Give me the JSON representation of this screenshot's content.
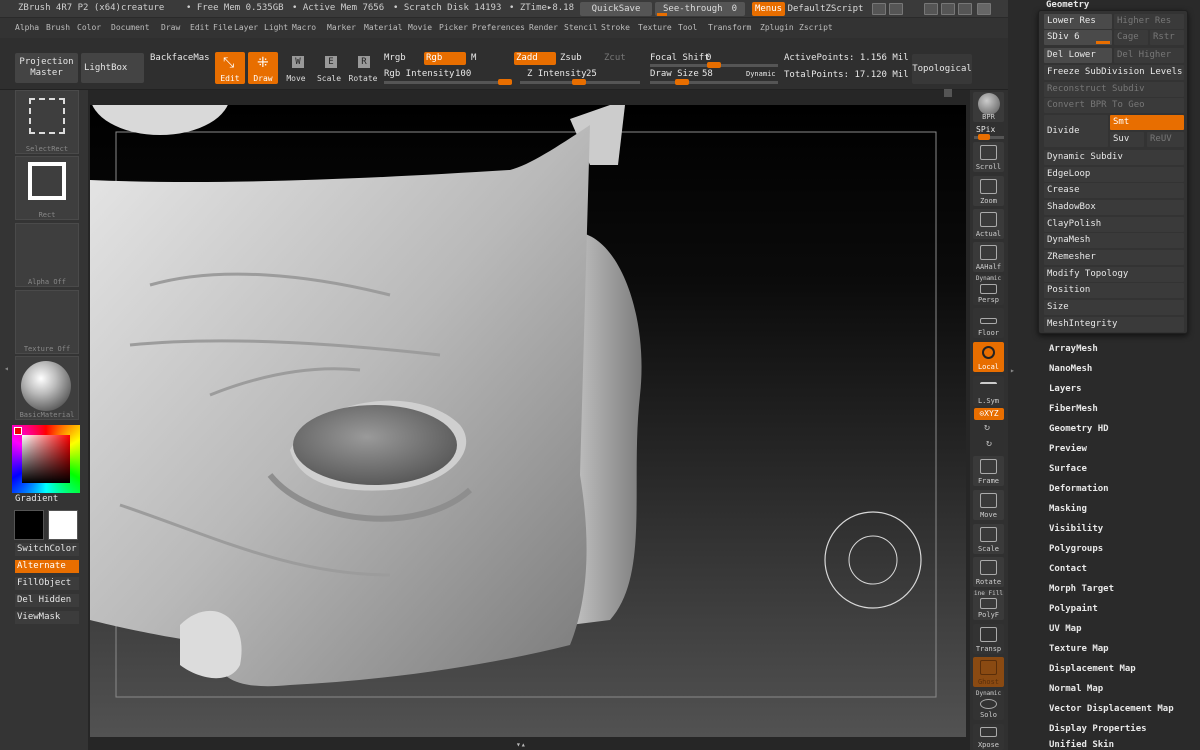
{
  "titlebar": {
    "app_title": "ZBrush 4R7 P2 (x64)creature",
    "free_mem": "• Free Mem 0.535GB",
    "active_mem": "• Active Mem 7656",
    "scratch_disk": "• Scratch Disk 14193",
    "ztime": "• ZTime▸8.18",
    "quicksave": "QuickSave",
    "seethrough": "See-through",
    "seethrough_value": "0",
    "menus": "Menus",
    "defaultzscript": "DefaultZScript"
  },
  "menubar": [
    "Alpha",
    "Brush",
    "Color",
    "Document",
    "Draw",
    "Edit",
    "File",
    "Layer",
    "Light",
    "Macro",
    "Marker",
    "Material",
    "Movie",
    "Picker",
    "Preferences",
    "Render",
    "Stencil",
    "Stroke",
    "Texture",
    "Tool",
    "Transform",
    "Zplugin",
    "Zscript"
  ],
  "shelf": {
    "projection_master": "Projection Master",
    "lightbox": "LightBox",
    "backface": "BackfaceMas",
    "edit": "Edit",
    "draw": "Draw",
    "move": "Move",
    "scale": "Scale",
    "rotate": "Rotate",
    "mrgb": "Mrgb",
    "rgb": "Rgb",
    "m": "M",
    "zadd": "Zadd",
    "zsub": "Zsub",
    "zcut": "Zcut",
    "rgb_intensity_label": "Rgb Intensity",
    "rgb_intensity": "100",
    "z_intensity_label": "Z Intensity",
    "z_intensity": "25",
    "focal_shift_label": "Focal Shift",
    "focal_shift": "0",
    "draw_size_label": "Draw Size",
    "draw_size": "58",
    "dynamic": "Dynamic",
    "active_points": "ActivePoints: 1.156 Mil",
    "total_points": "TotalPoints: 17.120 Mil",
    "topological": "Topological"
  },
  "leftpanel": {
    "selectrect": "SelectRect",
    "rect": "Rect",
    "alpha_off": "Alpha Off",
    "texture_off": "Texture Off",
    "basicmaterial": "BasicMaterial",
    "gradient": "Gradient",
    "switchcolor": "SwitchColor",
    "alternate": "Alternate",
    "fillobject": "FillObject",
    "del_hidden": "Del Hidden",
    "viewmask": "ViewMask"
  },
  "righttoolbar": {
    "bpr": "BPR",
    "spix": "SPix",
    "scroll": "Scroll",
    "zoom": "Zoom",
    "actual": "Actual",
    "aahalf": "AAHalf",
    "dynamic": "Dynamic",
    "persp": "Persp",
    "floor": "Floor",
    "local": "Local",
    "lsym": "L.Sym",
    "xyz": "⊙XYZ",
    "frame": "Frame",
    "move": "Move",
    "scale": "Scale",
    "rotate": "Rotate",
    "linefill": "ine Fill",
    "polyf": "PolyF",
    "transp": "Transp",
    "ghost": "Ghost",
    "dynamic2": "Dynamic",
    "solo": "Solo",
    "xpose": "Xpose"
  },
  "geometry": {
    "header": "Geometry",
    "lower_res": "Lower Res",
    "higher_res": "Higher Res",
    "sdiv_label": "SDiv",
    "sdiv": "6",
    "cage": "Cage",
    "rstr": "Rstr",
    "del_lower": "Del Lower",
    "del_higher": "Del Higher",
    "freeze": "Freeze SubDivision Levels",
    "reconstruct": "Reconstruct Subdiv",
    "convert_bpr": "Convert BPR To Geo",
    "divide": "Divide",
    "smt": "Smt",
    "suv": "Suv",
    "reuv": "ReUV",
    "items": [
      "Dynamic Subdiv",
      "EdgeLoop",
      "Crease",
      "ShadowBox",
      "ClayPolish",
      "DynaMesh",
      "ZRemesher",
      "Modify Topology",
      "Position",
      "Size",
      "MeshIntegrity"
    ]
  },
  "subtools": [
    "ArrayMesh",
    "NanoMesh",
    "Layers",
    "FiberMesh",
    "Geometry HD",
    "Preview",
    "Surface",
    "Deformation",
    "Masking",
    "Visibility",
    "Polygroups",
    "Contact",
    "Morph Target",
    "Polypaint",
    "UV Map",
    "Texture Map",
    "Displacement Map",
    "Normal Map",
    "Vector Displacement Map",
    "Display Properties",
    "Unified Skin"
  ],
  "colors": {
    "accent": "#e86e00",
    "panel": "#333333"
  }
}
